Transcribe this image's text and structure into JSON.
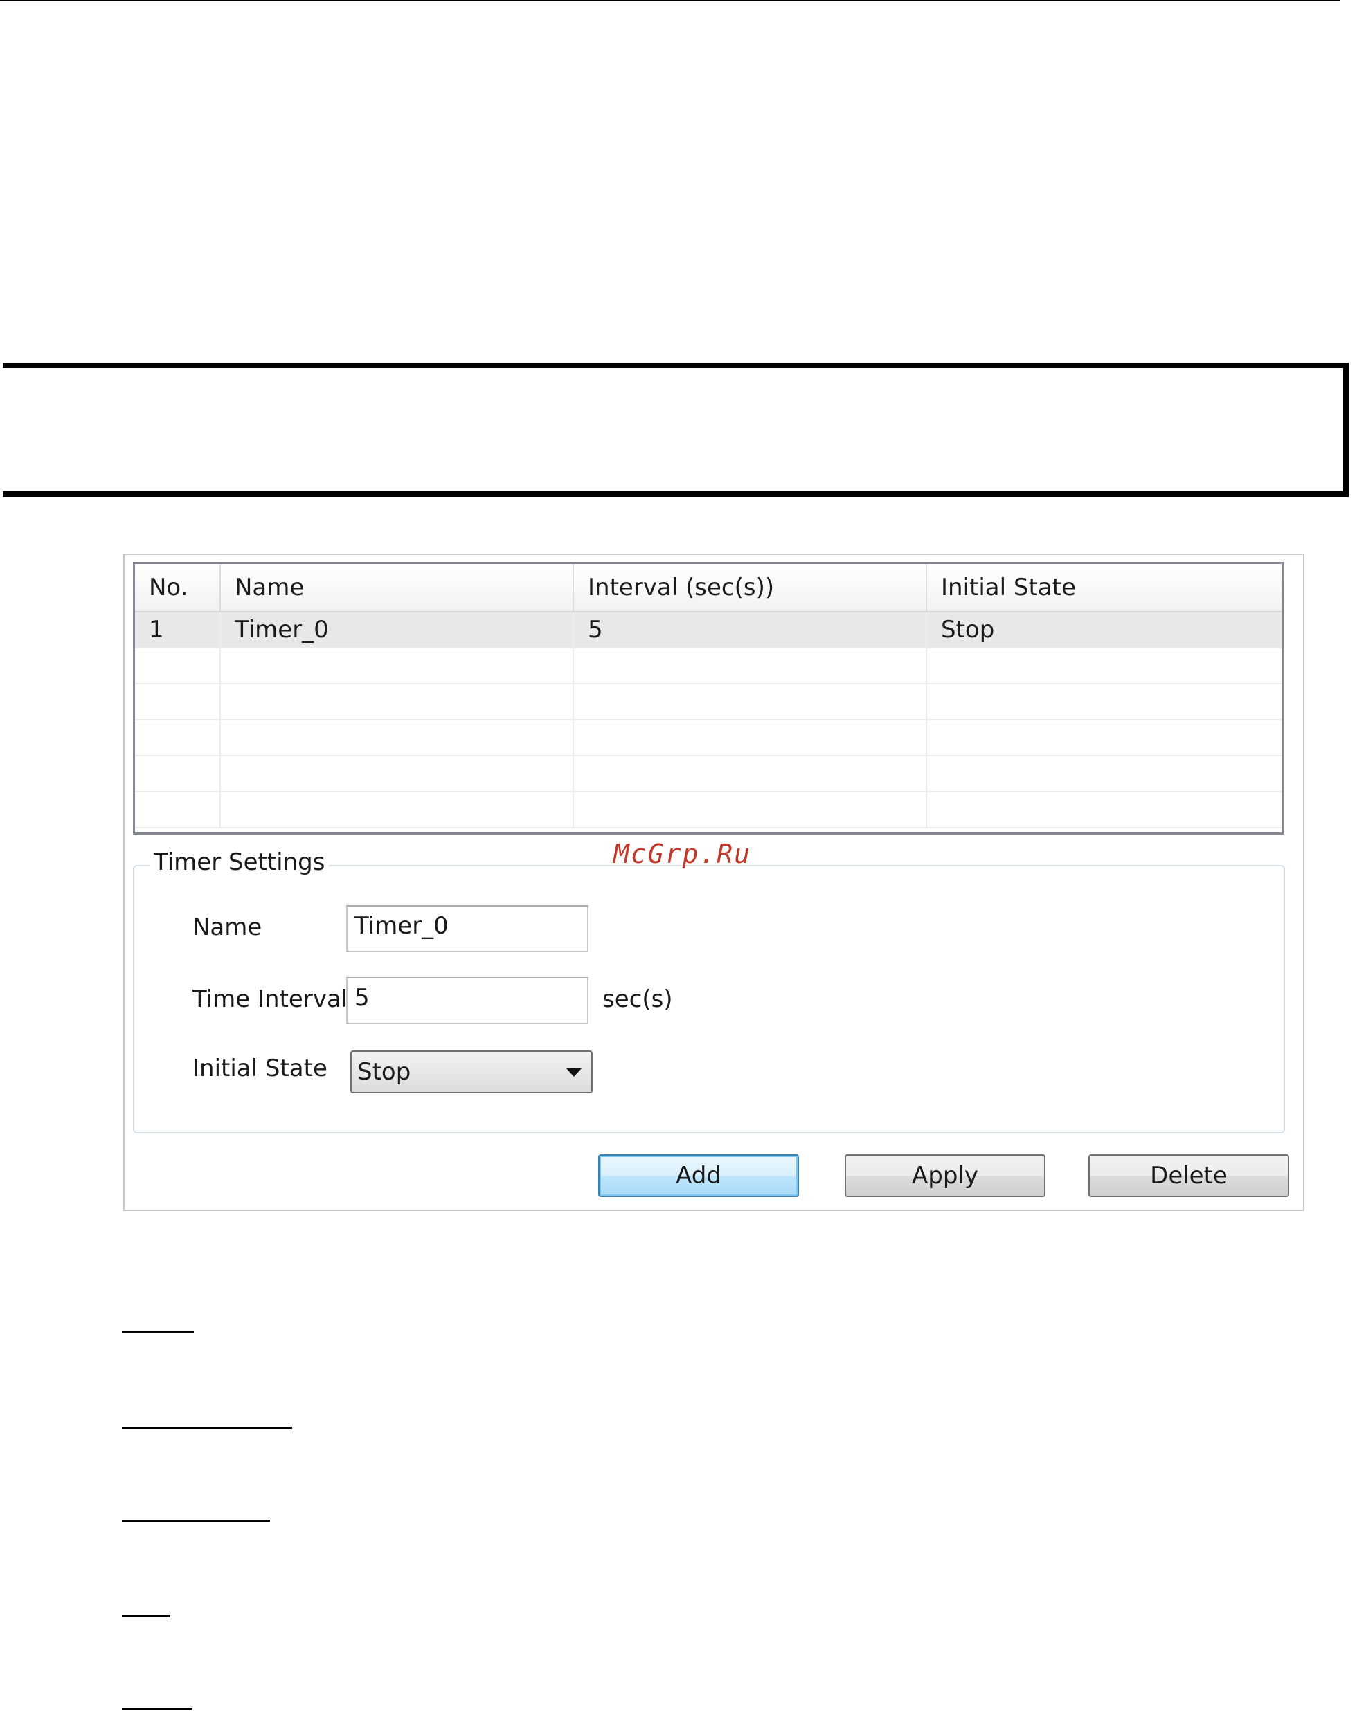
{
  "watermark": "McGrp.Ru",
  "timer_list": {
    "columns": [
      "No.",
      "Name",
      "Interval (sec(s))",
      "Initial State"
    ],
    "rows": [
      {
        "no": "1",
        "name": "Timer_0",
        "interval": "5",
        "initial_state": "Stop"
      }
    ]
  },
  "timer_settings": {
    "title": "Timer Settings",
    "name_label": "Name",
    "name_value": "Timer_0",
    "interval_label": "Time Interval",
    "interval_value": "5",
    "interval_unit": "sec(s)",
    "state_label": "Initial State",
    "state_value": "Stop"
  },
  "buttons": {
    "add": "Add",
    "apply": "Apply",
    "delete": "Delete"
  }
}
